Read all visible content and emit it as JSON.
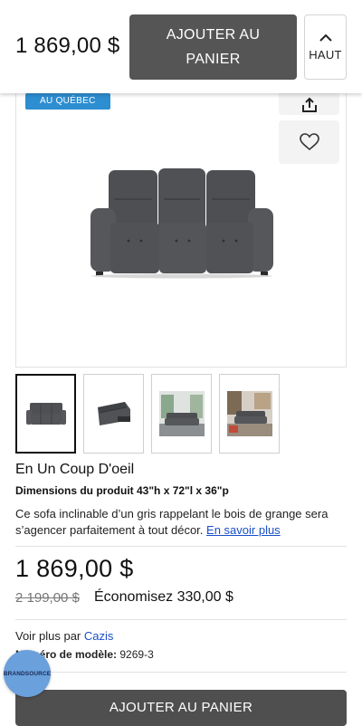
{
  "header": {
    "price": "1 869,00 $",
    "add_to_cart": "AJOUTER AU PANIER",
    "top_button": "HAUT",
    "top_icon": "chevron-up-icon"
  },
  "gallery": {
    "badge": "AU QUÉBEC",
    "share_icon": "share-icon",
    "wishlist_icon": "heart-icon",
    "main_image": "grey-reclining-sofa",
    "thumbnails": [
      {
        "name": "sofa-front",
        "selected": true
      },
      {
        "name": "sofa-reclined",
        "selected": false
      },
      {
        "name": "sofa-living-room",
        "selected": false
      },
      {
        "name": "sofa-room-scene",
        "selected": false
      }
    ]
  },
  "overview": {
    "title": "En Un Coup D'oeil",
    "dimensions": "Dimensions du produit 43\"h x 72\"l x 36\"p",
    "description": "Ce sofa inclinable d’un gris rappelant le bois de grange sera s’agencer parfaitement à tout décor.",
    "learn_more": "En savoir plus"
  },
  "pricing": {
    "price": "1 869,00 $",
    "old_price": "2 199,00 $",
    "savings": "Économisez 330,00 $"
  },
  "details": {
    "brand_prefix": "Voir plus par",
    "brand": "Cazis",
    "model_label": "Numéro de modèle:",
    "model_number": "9269-3"
  },
  "chat": {
    "logo_text": "BRANDSOURCE"
  },
  "footer": {
    "add_to_cart": "AJOUTER AU PANIER"
  },
  "colors": {
    "button_dark": "#555555",
    "badge_blue": "#2d8ed1",
    "link_blue": "#1a4fc7"
  }
}
